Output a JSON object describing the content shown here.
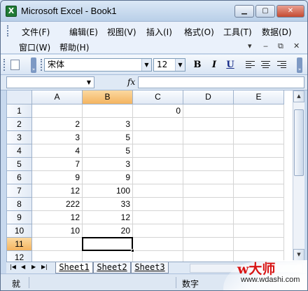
{
  "window": {
    "title": "Microsoft Excel - Book1",
    "app_icon": "X",
    "minimize": "▁",
    "restore": "▢",
    "close": "✕"
  },
  "menu": {
    "items": [
      "文件(F)",
      "编辑(E)",
      "视图(V)",
      "插入(I)",
      "格式(O)",
      "工具(T)",
      "数据(D)",
      "窗口(W)",
      "帮助(H)"
    ],
    "doc_controls": [
      "▾",
      "‒",
      "⧉",
      "✕"
    ]
  },
  "toolbar": {
    "font_name": "宋体",
    "font_size": "12",
    "bold": "B",
    "italic": "I",
    "underline": "U",
    "dropdown_arrow": "▼"
  },
  "formula_bar": {
    "fx_label": "fx",
    "name_box_value": "",
    "formula_value": ""
  },
  "grid": {
    "columns": [
      "A",
      "B",
      "C",
      "D",
      "E"
    ],
    "rows": [
      "1",
      "2",
      "3",
      "4",
      "5",
      "6",
      "7",
      "8",
      "9",
      "10",
      "11",
      "12"
    ],
    "cells": [
      [
        "",
        "",
        "0",
        "",
        ""
      ],
      [
        "2",
        "3",
        "",
        "",
        ""
      ],
      [
        "3",
        "5",
        "",
        "",
        ""
      ],
      [
        "4",
        "5",
        "",
        "",
        ""
      ],
      [
        "7",
        "3",
        "",
        "",
        ""
      ],
      [
        "9",
        "9",
        "",
        "",
        ""
      ],
      [
        "12",
        "100",
        "",
        "",
        ""
      ],
      [
        "222",
        "33",
        "",
        "",
        ""
      ],
      [
        "12",
        "12",
        "",
        "",
        ""
      ],
      [
        "10",
        "20",
        "",
        "",
        ""
      ],
      [
        "",
        "",
        "",
        "",
        ""
      ],
      [
        "",
        "",
        "",
        "",
        ""
      ]
    ],
    "selected_column": "B",
    "selected_row": "11"
  },
  "sheets": {
    "tabs": [
      "Sheet1",
      "Sheet2",
      "Sheet3"
    ],
    "active": "Sheet1",
    "nav": [
      "|◀",
      "◀",
      "▶",
      "▶|"
    ]
  },
  "status": {
    "ready": "就",
    "mode": "数字"
  },
  "watermark": {
    "brand": "w大师",
    "url": "www.wdashi.com"
  }
}
